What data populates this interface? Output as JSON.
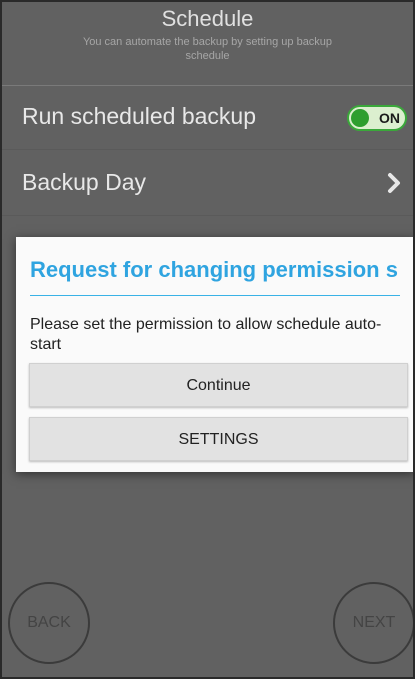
{
  "header": {
    "title": "Schedule",
    "subtitle": "You can automate the backup by setting up backup schedule"
  },
  "rows": {
    "run_scheduled_backup": {
      "label": "Run scheduled backup",
      "toggle_state": "ON",
      "toggle_color": "#3aa83a"
    },
    "backup_day": {
      "label": "Backup Day",
      "icon": "chevron-right-icon"
    }
  },
  "dialog": {
    "title": "Request for changing permission s",
    "message": "Please set the permission to allow schedule auto-start",
    "continue_label": "Continue",
    "settings_label": "SETTINGS",
    "accent_color": "#2fa4e0"
  },
  "nav": {
    "back_label": "BACK",
    "next_label": "NEXT"
  }
}
